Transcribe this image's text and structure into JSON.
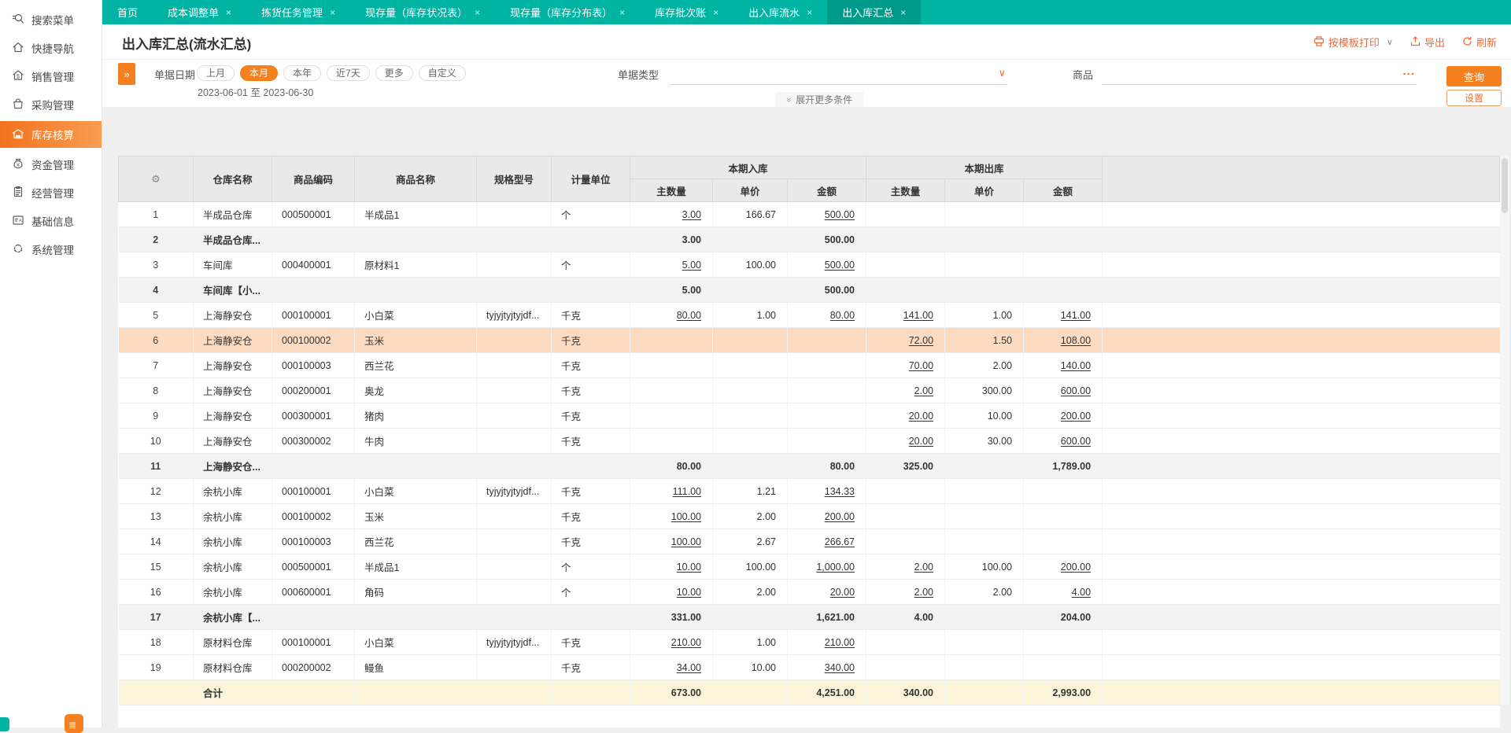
{
  "colors": {
    "teal": "#00b4a4",
    "teal_active_tab": "#009a8b",
    "accent_orange": "#f0702f",
    "button_orange": "#f5801f",
    "highlight_row": "#fcdbc0",
    "subtotal_bg": "#f2f2f2",
    "total_row_bg": "#fbf3da",
    "header_bg": "#e9e9e9"
  },
  "sidebar": {
    "items": [
      {
        "label": "搜索菜单",
        "icon": "search-menu-icon",
        "active": false
      },
      {
        "label": "快捷导航",
        "icon": "home-nav-icon",
        "active": false
      },
      {
        "label": "销售管理",
        "icon": "sales-house-icon",
        "active": false
      },
      {
        "label": "采购管理",
        "icon": "purchase-bag-icon",
        "active": false
      },
      {
        "label": "库存核算",
        "icon": "inventory-warehouse-icon",
        "active": true
      },
      {
        "label": "资金管理",
        "icon": "funds-moneybag-icon",
        "active": false
      },
      {
        "label": "经营管理",
        "icon": "operations-clipboard-icon",
        "active": false
      },
      {
        "label": "基础信息",
        "icon": "basic-info-card-icon",
        "active": false
      },
      {
        "label": "系统管理",
        "icon": "system-dashed-circle-icon",
        "active": false
      }
    ]
  },
  "tabs": {
    "items": [
      {
        "label": "首页",
        "closable": false,
        "active": false
      },
      {
        "label": "成本调整单",
        "closable": true,
        "active": false
      },
      {
        "label": "拣货任务管理",
        "closable": true,
        "active": false
      },
      {
        "label": "现存量（库存状况表）",
        "closable": true,
        "active": false
      },
      {
        "label": "现存量（库存分布表）",
        "closable": true,
        "active": false
      },
      {
        "label": "库存批次账",
        "closable": true,
        "active": false
      },
      {
        "label": "出入库流水",
        "closable": true,
        "active": false
      },
      {
        "label": "出入库汇总",
        "closable": true,
        "active": true
      }
    ]
  },
  "page": {
    "title": "出入库汇总(流水汇总)",
    "actions": [
      {
        "label": "按模板打印",
        "icon": "printer-icon",
        "has_dropdown": true
      },
      {
        "label": "导出",
        "icon": "export-icon",
        "has_dropdown": false
      },
      {
        "label": "刷新",
        "icon": "refresh-icon",
        "has_dropdown": false
      }
    ]
  },
  "filters": {
    "collapse_glyph": "»",
    "doc_date": {
      "label": "单据日期",
      "options": [
        "上月",
        "本月",
        "本年",
        "近7天",
        "更多",
        "自定义"
      ],
      "selected": "本月",
      "range": "2023-06-01 至 2023-06-30"
    },
    "doc_type": {
      "label": "单据类型",
      "value": ""
    },
    "product": {
      "label": "商品",
      "value": ""
    },
    "query_button": "查询",
    "settings_button": "设置",
    "expand_more": "展开更多条件"
  },
  "table": {
    "corner_icon": "gear-icon",
    "group_headers": {
      "inbound": "本期入库",
      "outbound": "本期出库"
    },
    "columns": [
      "仓库名称",
      "商品编码",
      "商品名称",
      "规格型号",
      "计量单位"
    ],
    "sub_columns": [
      "主数量",
      "单价",
      "金额"
    ],
    "rows": [
      {
        "n": "1",
        "type": "detail",
        "hl": false,
        "cells": [
          "半成品仓库",
          "000500001",
          "半成品1",
          "",
          "个",
          "3.00",
          "166.67",
          "500.00",
          "",
          "",
          ""
        ]
      },
      {
        "n": "2",
        "type": "subtotal",
        "hl": false,
        "cells": [
          "半成品仓库...",
          "",
          "",
          "",
          "",
          "3.00",
          "",
          "500.00",
          "",
          "",
          ""
        ]
      },
      {
        "n": "3",
        "type": "detail",
        "hl": false,
        "cells": [
          "车间库",
          "000400001",
          "原材料1",
          "",
          "个",
          "5.00",
          "100.00",
          "500.00",
          "",
          "",
          ""
        ]
      },
      {
        "n": "4",
        "type": "subtotal",
        "hl": false,
        "cells": [
          "车间库【小...",
          "",
          "",
          "",
          "",
          "5.00",
          "",
          "500.00",
          "",
          "",
          ""
        ]
      },
      {
        "n": "5",
        "type": "detail",
        "hl": false,
        "cells": [
          "上海静安仓",
          "000100001",
          "小白菜",
          "tyjyjtyjtyjdf...",
          "千克",
          "80.00",
          "1.00",
          "80.00",
          "141.00",
          "1.00",
          "141.00"
        ]
      },
      {
        "n": "6",
        "type": "detail",
        "hl": true,
        "cells": [
          "上海静安仓",
          "000100002",
          "玉米",
          "",
          "千克",
          "",
          "",
          "",
          "72.00",
          "1.50",
          "108.00"
        ]
      },
      {
        "n": "7",
        "type": "detail",
        "hl": false,
        "cells": [
          "上海静安仓",
          "000100003",
          "西兰花",
          "",
          "千克",
          "",
          "",
          "",
          "70.00",
          "2.00",
          "140.00"
        ]
      },
      {
        "n": "8",
        "type": "detail",
        "hl": false,
        "cells": [
          "上海静安仓",
          "000200001",
          "奥龙",
          "",
          "千克",
          "",
          "",
          "",
          "2.00",
          "300.00",
          "600.00"
        ]
      },
      {
        "n": "9",
        "type": "detail",
        "hl": false,
        "cells": [
          "上海静安仓",
          "000300001",
          "猪肉",
          "",
          "千克",
          "",
          "",
          "",
          "20.00",
          "10.00",
          "200.00"
        ]
      },
      {
        "n": "10",
        "type": "detail",
        "hl": false,
        "cells": [
          "上海静安仓",
          "000300002",
          "牛肉",
          "",
          "千克",
          "",
          "",
          "",
          "20.00",
          "30.00",
          "600.00"
        ]
      },
      {
        "n": "11",
        "type": "subtotal",
        "hl": false,
        "cells": [
          "上海静安仓...",
          "",
          "",
          "",
          "",
          "80.00",
          "",
          "80.00",
          "325.00",
          "",
          "1,789.00"
        ]
      },
      {
        "n": "12",
        "type": "detail",
        "hl": false,
        "cells": [
          "余杭小库",
          "000100001",
          "小白菜",
          "tyjyjtyjtyjdf...",
          "千克",
          "111.00",
          "1.21",
          "134.33",
          "",
          "",
          ""
        ]
      },
      {
        "n": "13",
        "type": "detail",
        "hl": false,
        "cells": [
          "余杭小库",
          "000100002",
          "玉米",
          "",
          "千克",
          "100.00",
          "2.00",
          "200.00",
          "",
          "",
          ""
        ]
      },
      {
        "n": "14",
        "type": "detail",
        "hl": false,
        "cells": [
          "余杭小库",
          "000100003",
          "西兰花",
          "",
          "千克",
          "100.00",
          "2.67",
          "266.67",
          "",
          "",
          ""
        ]
      },
      {
        "n": "15",
        "type": "detail",
        "hl": false,
        "cells": [
          "余杭小库",
          "000500001",
          "半成品1",
          "",
          "个",
          "10.00",
          "100.00",
          "1,000.00",
          "2.00",
          "100.00",
          "200.00"
        ]
      },
      {
        "n": "16",
        "type": "detail",
        "hl": false,
        "cells": [
          "余杭小库",
          "000600001",
          "角码",
          "",
          "个",
          "10.00",
          "2.00",
          "20.00",
          "2.00",
          "2.00",
          "4.00"
        ]
      },
      {
        "n": "17",
        "type": "subtotal",
        "hl": false,
        "cells": [
          "余杭小库【...",
          "",
          "",
          "",
          "",
          "331.00",
          "",
          "1,621.00",
          "4.00",
          "",
          "204.00"
        ]
      },
      {
        "n": "18",
        "type": "detail",
        "hl": false,
        "cells": [
          "原材料仓库",
          "000100001",
          "小白菜",
          "tyjyjtyjtyjdf...",
          "千克",
          "210.00",
          "1.00",
          "210.00",
          "",
          "",
          ""
        ]
      },
      {
        "n": "19",
        "type": "detail",
        "hl": false,
        "cells": [
          "原材料仓库",
          "000200002",
          "鳗鱼",
          "",
          "千克",
          "34.00",
          "10.00",
          "340.00",
          "",
          "",
          ""
        ]
      },
      {
        "n": "",
        "type": "total",
        "hl": false,
        "cells": [
          "合计",
          "",
          "",
          "",
          "",
          "673.00",
          "",
          "4,251.00",
          "340.00",
          "",
          "2,993.00"
        ]
      }
    ]
  }
}
